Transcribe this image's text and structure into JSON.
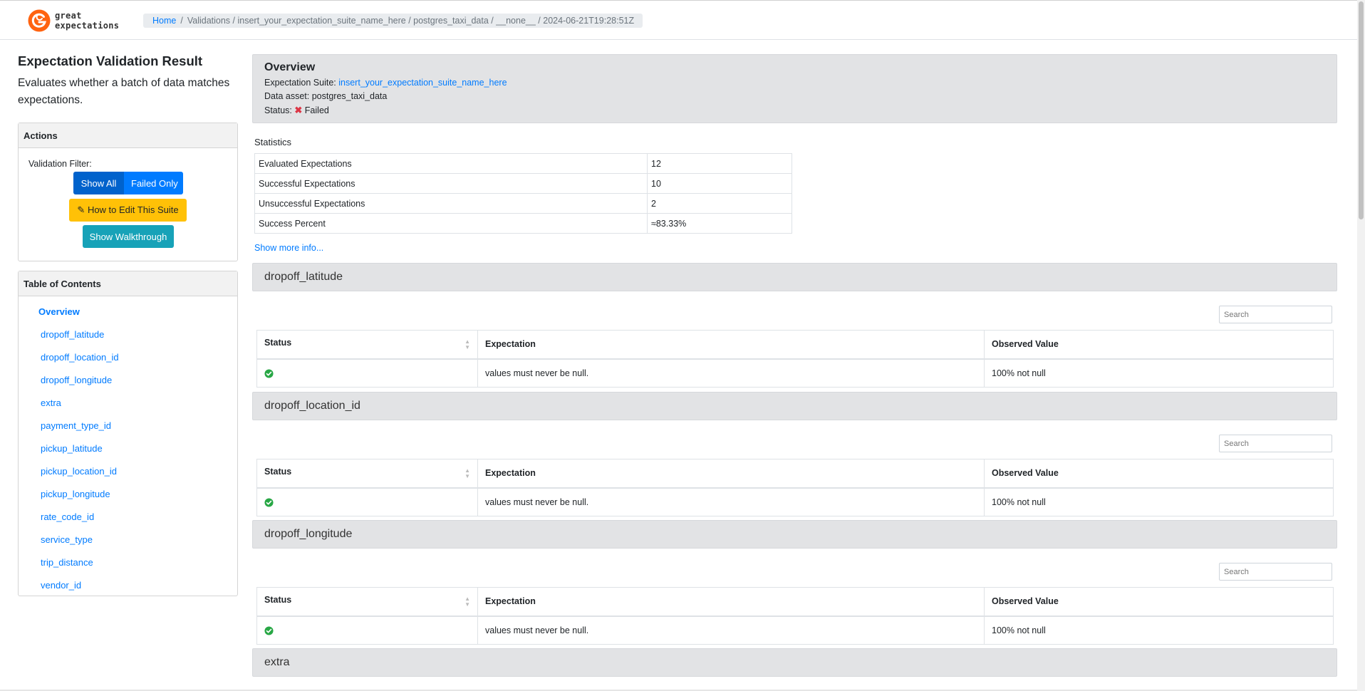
{
  "brand": {
    "name_line1": "great",
    "name_line2": "expectations",
    "accent": "#ff6310"
  },
  "breadcrumb": {
    "home": "Home",
    "trail": "Validations / insert_your_expectation_suite_name_here / postgres_taxi_data / __none__ / 2024-06-21T19:28:51Z"
  },
  "sidebar": {
    "title": "Expectation Validation Result",
    "subtitle": "Evaluates whether a batch of data matches expectations.",
    "actions": {
      "header": "Actions",
      "filter_label": "Validation Filter:",
      "show_all": "Show All",
      "failed_only": "Failed Only",
      "edit_suite": "How to Edit This Suite",
      "walkthrough": "Show Walkthrough"
    },
    "toc": {
      "header": "Table of Contents",
      "overview": "Overview",
      "items": [
        "dropoff_latitude",
        "dropoff_location_id",
        "dropoff_longitude",
        "extra",
        "payment_type_id",
        "pickup_latitude",
        "pickup_location_id",
        "pickup_longitude",
        "rate_code_id",
        "service_type",
        "trip_distance",
        "vendor_id"
      ]
    }
  },
  "overview": {
    "title": "Overview",
    "suite_label": "Expectation Suite:",
    "suite_name": "insert_your_expectation_suite_name_here",
    "asset_label": "Data asset:",
    "asset_name": "postgres_taxi_data",
    "status_label": "Status:",
    "status": "Failed",
    "status_color": "#dc3545"
  },
  "statistics": {
    "label": "Statistics",
    "rows": [
      {
        "key": "Evaluated Expectations",
        "value": "12"
      },
      {
        "key": "Successful Expectations",
        "value": "10"
      },
      {
        "key": "Unsuccessful Expectations",
        "value": "2"
      },
      {
        "key": "Success Percent",
        "value": "≈83.33%"
      }
    ],
    "show_more": "Show more info..."
  },
  "sections": [
    {
      "name": "dropoff_latitude",
      "search_placeholder": "Search",
      "headers": {
        "status": "Status",
        "expectation": "Expectation",
        "observed": "Observed Value"
      },
      "rows": [
        {
          "status": "success-icon",
          "expectation": "values must never be null.",
          "observed": "100% not null"
        }
      ]
    },
    {
      "name": "dropoff_location_id",
      "search_placeholder": "Search",
      "headers": {
        "status": "Status",
        "expectation": "Expectation",
        "observed": "Observed Value"
      },
      "rows": [
        {
          "status": "success-icon",
          "expectation": "values must never be null.",
          "observed": "100% not null"
        }
      ]
    },
    {
      "name": "dropoff_longitude",
      "search_placeholder": "Search",
      "headers": {
        "status": "Status",
        "expectation": "Expectation",
        "observed": "Observed Value"
      },
      "rows": [
        {
          "status": "success-icon",
          "expectation": "values must never be null.",
          "observed": "100% not null"
        }
      ]
    },
    {
      "name": "extra"
    }
  ],
  "colors": {
    "primary": "#007bff",
    "success": "#28a745",
    "warning": "#ffc107",
    "info": "#17a2b8"
  }
}
